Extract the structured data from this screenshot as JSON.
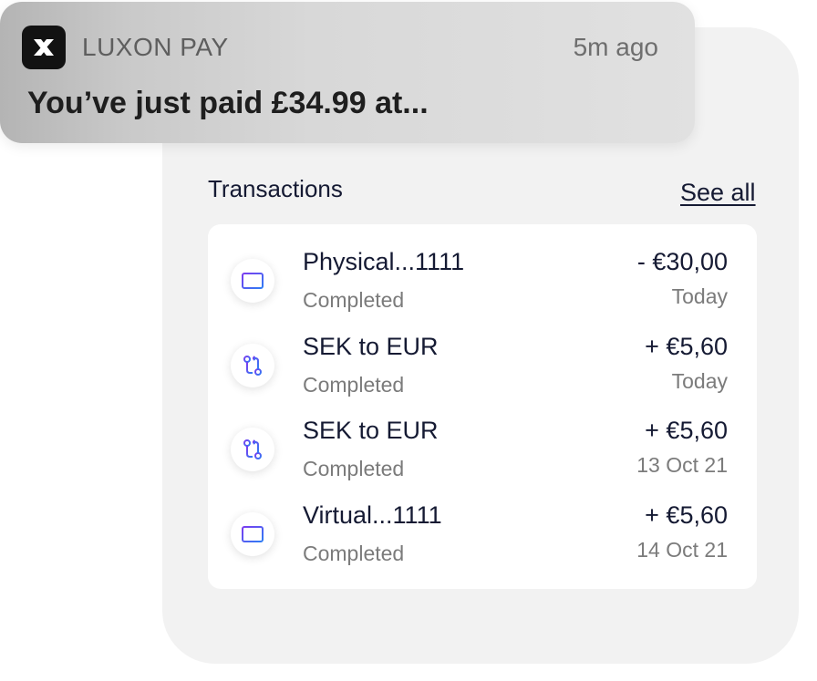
{
  "notification": {
    "app_name": "LUXON PAY",
    "time": "5m ago",
    "message": "You’ve just paid £34.99 at...",
    "logo_icon": "luxon-logo-icon"
  },
  "transactions": {
    "title": "Transactions",
    "see_all": "See all",
    "items": [
      {
        "icon": "card-icon",
        "name": "Physical...1111",
        "status": "Completed",
        "amount": "- €30,00",
        "date": "Today"
      },
      {
        "icon": "exchange-icon",
        "name": "SEK to EUR",
        "status": "Completed",
        "amount": "+ €5,60",
        "date": "Today"
      },
      {
        "icon": "exchange-icon",
        "name": "SEK to EUR",
        "status": "Completed",
        "amount": "+ €5,60",
        "date": "13 Oct 21"
      },
      {
        "icon": "card-icon",
        "name": "Virtual...1111",
        "status": "Completed",
        "amount": "+ €5,60",
        "date": "14 Oct 21"
      }
    ]
  },
  "colors": {
    "text": "#151a33",
    "muted": "#7b7b7b",
    "icon_gradient_start": "#7b3cf0",
    "icon_gradient_end": "#2f7df4"
  }
}
